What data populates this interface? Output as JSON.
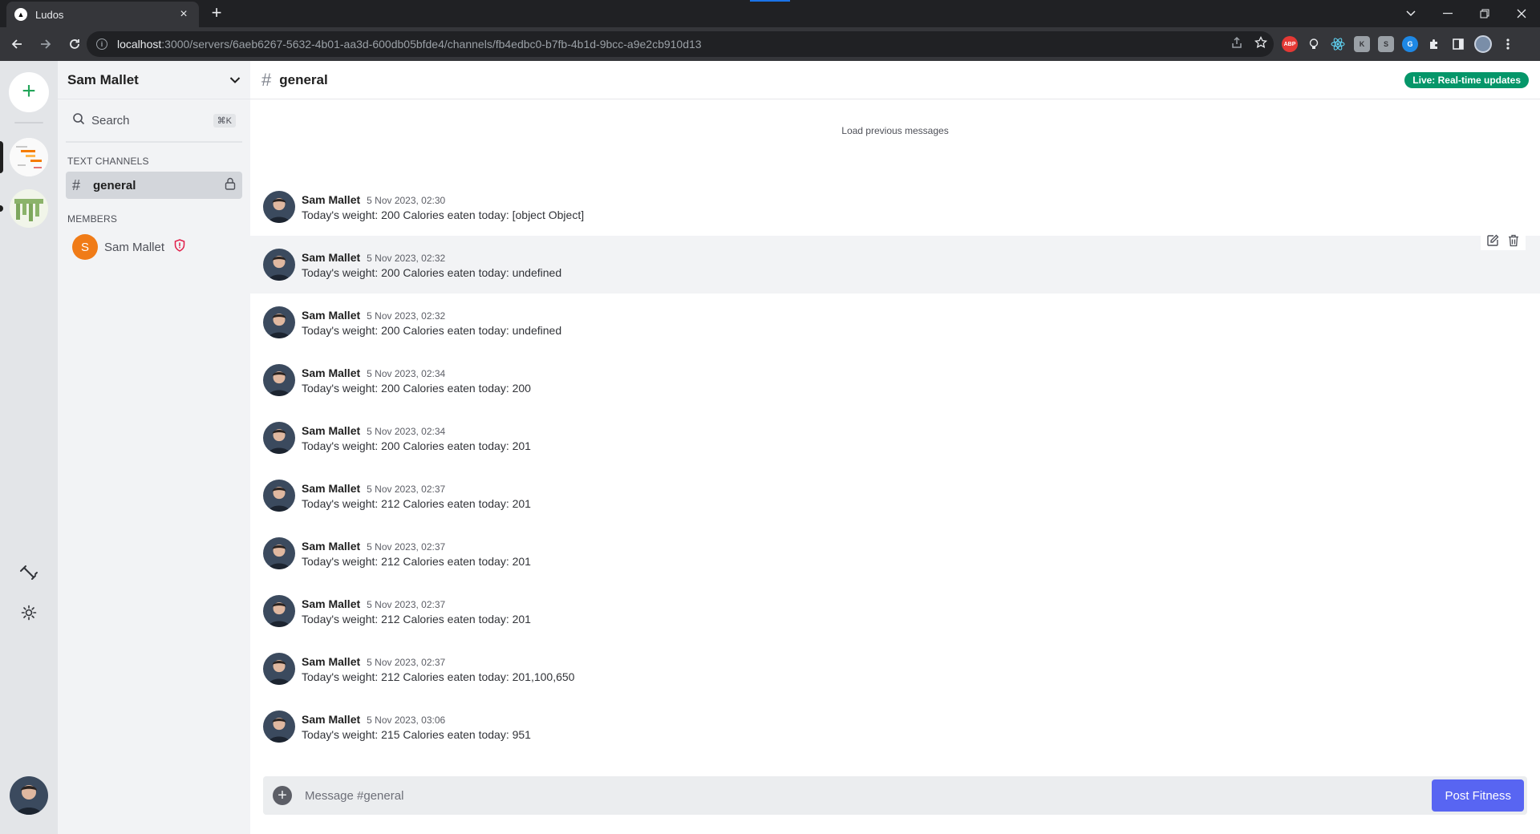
{
  "browser": {
    "tab_title": "Ludos",
    "favicon_glyph": "▲",
    "url_host": "localhost",
    "url_path": ":3000/servers/6aeb6267-5632-4b01-aa3d-600db05bfde4/channels/fb4edbc0-b7fb-4b1d-9bcc-a9e2cb910d13",
    "extensions": [
      "ABP",
      "bulb",
      "react",
      "k",
      "s",
      "g"
    ]
  },
  "server": {
    "name": "Sam Mallet"
  },
  "search": {
    "label": "Search",
    "shortcut": "⌘K"
  },
  "sections": {
    "text_channels": "TEXT CHANNELS",
    "members": "MEMBERS"
  },
  "channel": {
    "name": "general"
  },
  "member": {
    "initial": "S",
    "name": "Sam Mallet"
  },
  "header": {
    "channel_name": "general",
    "live_badge": "Live: Real-time updates"
  },
  "load_previous": "Load previous messages",
  "messages": [
    {
      "author": "Sam Mallet",
      "time": "5 Nov 2023, 02:30",
      "text": "Today's weight: 200 Calories eaten today: [object Object]"
    },
    {
      "author": "Sam Mallet",
      "time": "5 Nov 2023, 02:32",
      "text": "Today's weight: 200 Calories eaten today: undefined"
    },
    {
      "author": "Sam Mallet",
      "time": "5 Nov 2023, 02:32",
      "text": "Today's weight: 200 Calories eaten today: undefined"
    },
    {
      "author": "Sam Mallet",
      "time": "5 Nov 2023, 02:34",
      "text": "Today's weight: 200 Calories eaten today: 200"
    },
    {
      "author": "Sam Mallet",
      "time": "5 Nov 2023, 02:34",
      "text": "Today's weight: 200 Calories eaten today: 201"
    },
    {
      "author": "Sam Mallet",
      "time": "5 Nov 2023, 02:37",
      "text": "Today's weight: 212 Calories eaten today: 201"
    },
    {
      "author": "Sam Mallet",
      "time": "5 Nov 2023, 02:37",
      "text": "Today's weight: 212 Calories eaten today: 201"
    },
    {
      "author": "Sam Mallet",
      "time": "5 Nov 2023, 02:37",
      "text": "Today's weight: 212 Calories eaten today: 201"
    },
    {
      "author": "Sam Mallet",
      "time": "5 Nov 2023, 02:37",
      "text": "Today's weight: 212 Calories eaten today: 201,100,650"
    },
    {
      "author": "Sam Mallet",
      "time": "5 Nov 2023, 03:06",
      "text": "Today's weight: 215 Calories eaten today: 951"
    }
  ],
  "composer": {
    "placeholder": "Message #general",
    "post_label": "Post Fitness"
  },
  "colors": {
    "accent": "#5865f2",
    "live": "#059669",
    "add_green": "#23a55a",
    "member_orange": "#f07b17",
    "admin_red": "#e11d48"
  }
}
